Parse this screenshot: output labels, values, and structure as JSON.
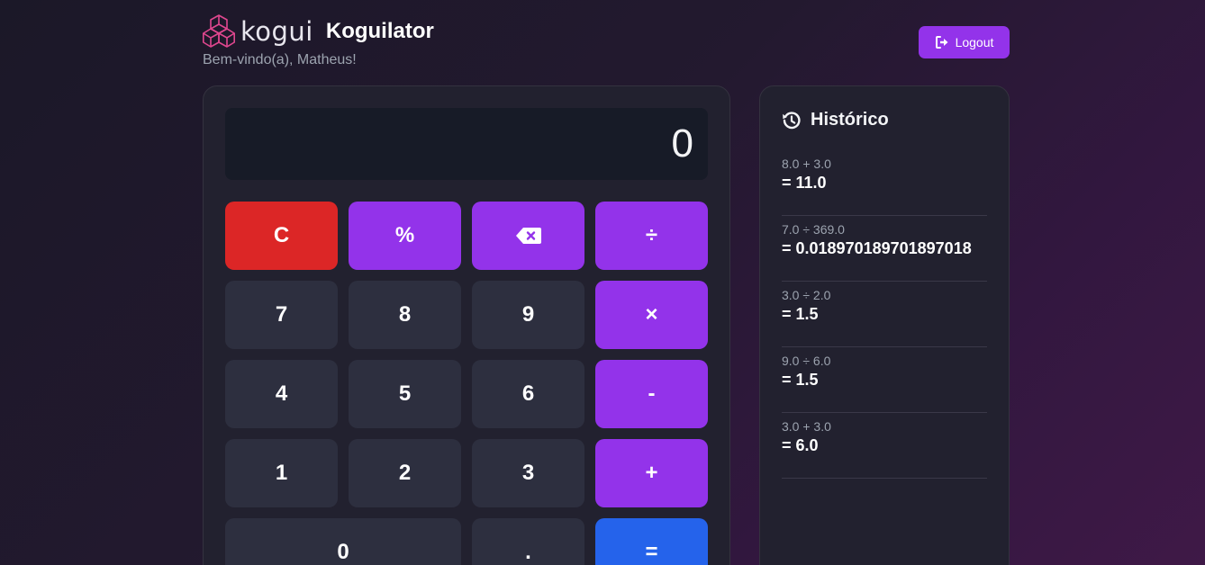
{
  "header": {
    "logo_text": "kogui",
    "app_title": "Koguilator",
    "welcome": "Bem-vindo(a), Matheus!",
    "logout_label": "Logout"
  },
  "calculator": {
    "display_value": "0",
    "buttons": {
      "clear": "C",
      "percent": "%",
      "divide": "÷",
      "seven": "7",
      "eight": "8",
      "nine": "9",
      "multiply": "×",
      "four": "4",
      "five": "5",
      "six": "6",
      "minus": "-",
      "one": "1",
      "two": "2",
      "three": "3",
      "plus": "+",
      "zero": "0",
      "dot": ".",
      "equals": "="
    }
  },
  "history": {
    "title": "Histórico",
    "items": [
      {
        "expression": "8.0 + 3.0",
        "result": "= 11.0"
      },
      {
        "expression": "7.0 ÷ 369.0",
        "result": "= 0.018970189701897018"
      },
      {
        "expression": "3.0 ÷ 2.0",
        "result": "= 1.5"
      },
      {
        "expression": "9.0 ÷ 6.0",
        "result": "= 1.5"
      },
      {
        "expression": "3.0 + 3.0",
        "result": "= 6.0"
      }
    ]
  },
  "colors": {
    "accent_purple": "#9333ea",
    "clear_red": "#dc2626",
    "equals_blue": "#2563eb",
    "logo_pink": "#e0478f"
  },
  "icons": {
    "logo": "kogui-hexagon-logo-icon",
    "logout": "logout-icon",
    "backspace": "backspace-icon",
    "history": "history-clock-icon"
  }
}
